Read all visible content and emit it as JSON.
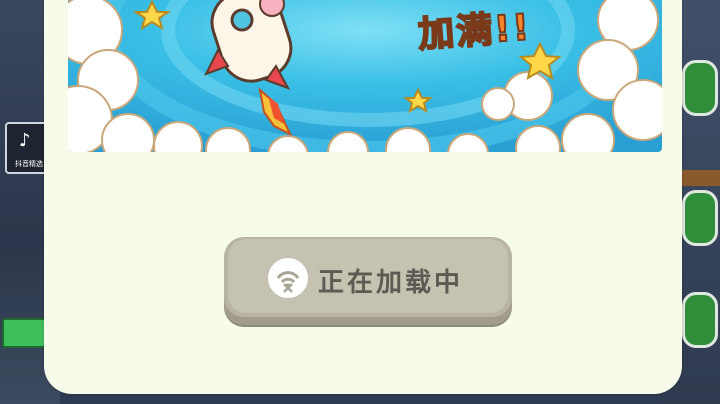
{
  "banner": {
    "headline": "加满!!"
  },
  "loading_button": {
    "label": "正在加载中"
  },
  "background": {
    "tiktok_badge_caption": "抖音精选"
  },
  "colors": {
    "modal_bg": "#f7fbea",
    "sky": "#2fb6de",
    "button_face": "#c6c2b1",
    "headline": "#f5842c"
  },
  "icons": [
    "rocket-icon",
    "star-icon",
    "no-signal-icon",
    "tiktok-icon"
  ]
}
